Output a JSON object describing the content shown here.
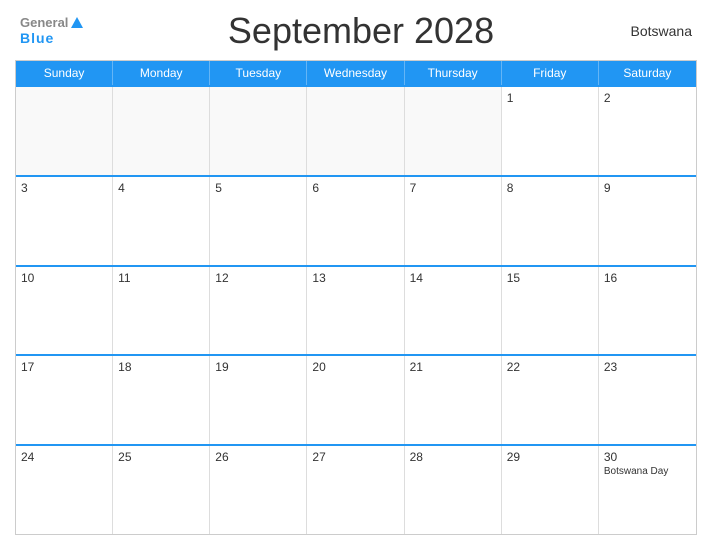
{
  "header": {
    "logo_general": "General",
    "logo_blue": "Blue",
    "title": "September 2028",
    "country": "Botswana"
  },
  "day_headers": [
    "Sunday",
    "Monday",
    "Tuesday",
    "Wednesday",
    "Thursday",
    "Friday",
    "Saturday"
  ],
  "weeks": [
    [
      {
        "date": "",
        "event": ""
      },
      {
        "date": "",
        "event": ""
      },
      {
        "date": "",
        "event": ""
      },
      {
        "date": "",
        "event": ""
      },
      {
        "date": "",
        "event": ""
      },
      {
        "date": "1",
        "event": ""
      },
      {
        "date": "2",
        "event": ""
      }
    ],
    [
      {
        "date": "3",
        "event": ""
      },
      {
        "date": "4",
        "event": ""
      },
      {
        "date": "5",
        "event": ""
      },
      {
        "date": "6",
        "event": ""
      },
      {
        "date": "7",
        "event": ""
      },
      {
        "date": "8",
        "event": ""
      },
      {
        "date": "9",
        "event": ""
      }
    ],
    [
      {
        "date": "10",
        "event": ""
      },
      {
        "date": "11",
        "event": ""
      },
      {
        "date": "12",
        "event": ""
      },
      {
        "date": "13",
        "event": ""
      },
      {
        "date": "14",
        "event": ""
      },
      {
        "date": "15",
        "event": ""
      },
      {
        "date": "16",
        "event": ""
      }
    ],
    [
      {
        "date": "17",
        "event": ""
      },
      {
        "date": "18",
        "event": ""
      },
      {
        "date": "19",
        "event": ""
      },
      {
        "date": "20",
        "event": ""
      },
      {
        "date": "21",
        "event": ""
      },
      {
        "date": "22",
        "event": ""
      },
      {
        "date": "23",
        "event": ""
      }
    ],
    [
      {
        "date": "24",
        "event": ""
      },
      {
        "date": "25",
        "event": ""
      },
      {
        "date": "26",
        "event": ""
      },
      {
        "date": "27",
        "event": ""
      },
      {
        "date": "28",
        "event": ""
      },
      {
        "date": "29",
        "event": ""
      },
      {
        "date": "30",
        "event": "Botswana Day"
      }
    ]
  ]
}
